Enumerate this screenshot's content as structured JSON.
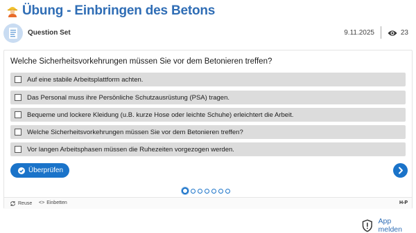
{
  "title": {
    "text": "Übung - Einbringen des Betons",
    "emoji": "construction-worker-emoji"
  },
  "meta": {
    "type_label": "Question Set",
    "date": "9.11.2025",
    "views": "23"
  },
  "question": {
    "text": "Welche Sicherheitsvorkehrungen müssen Sie vor dem Betonieren treffen?",
    "options": [
      {
        "label": "Auf eine stabile Arbeitsplattform achten."
      },
      {
        "label": "Das Personal muss ihre Persönliche Schutzausrüstung (PSA) tragen."
      },
      {
        "label": "Bequeme und lockere Kleidung (u.B. kurze Hose oder leichte Schuhe) erleichtert die Arbeit."
      },
      {
        "label": "Welche Sicherheitsvorkehrungen müssen Sie vor dem Betonieren treffen?"
      },
      {
        "label": "Vor langen Arbeitsphasen müssen die Ruhezeiten vorgezogen werden."
      }
    ]
  },
  "actions": {
    "check_label": "Überprüfen"
  },
  "pagination": {
    "total": 7,
    "current": 1
  },
  "footer": {
    "reuse_label": "Reuse",
    "embed_label": "Einbetten",
    "embed_icon": "<>",
    "brand": "H-P"
  },
  "report": {
    "label": "App melden"
  },
  "colors": {
    "accent": "#1a73c9",
    "title": "#2f6db5",
    "option_bg": "#dcdcdc"
  }
}
